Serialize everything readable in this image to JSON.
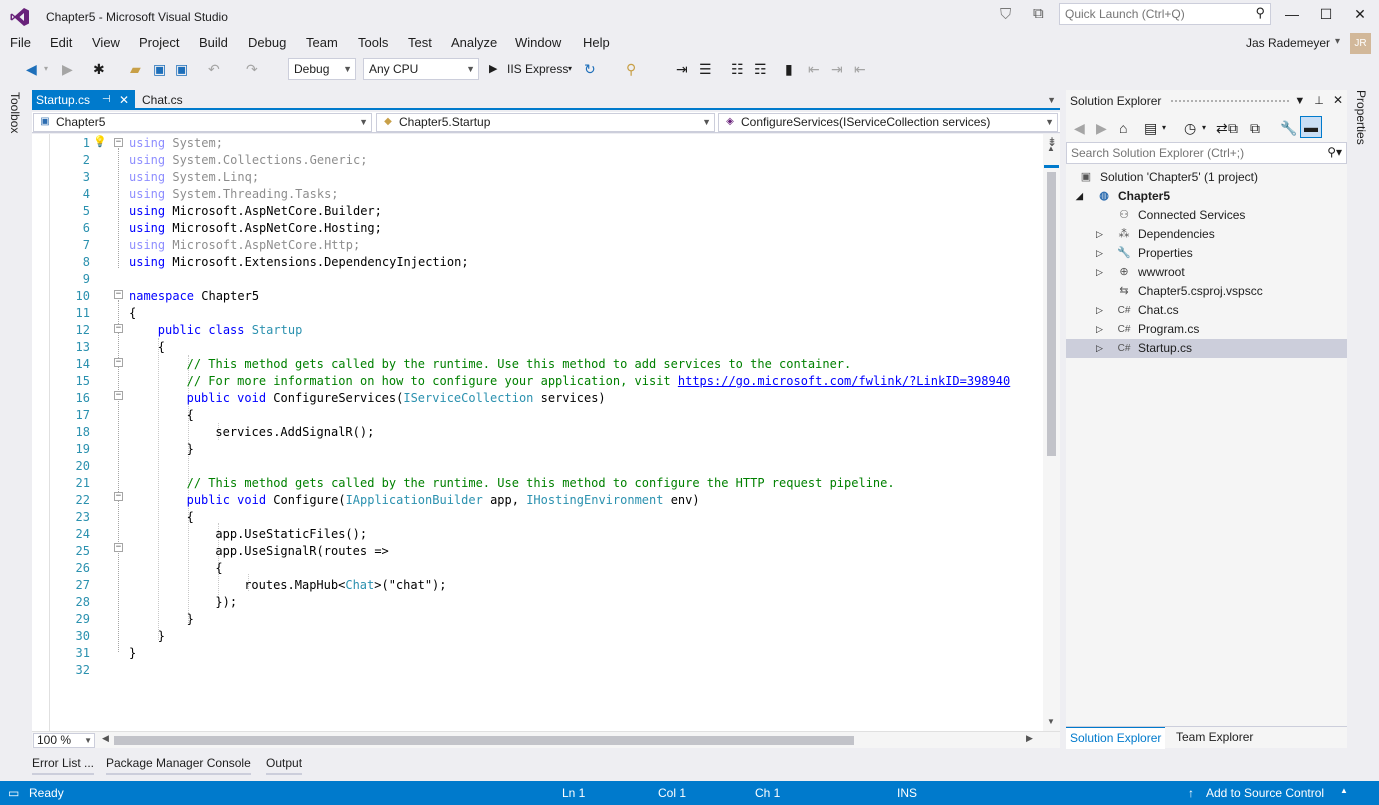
{
  "window": {
    "title": "Chapter5 - Microsoft Visual Studio",
    "quick_launch_placeholder": "Quick Launch (Ctrl+Q)",
    "controls": {
      "minimize": "—",
      "maximize": "☐",
      "close": "✕"
    }
  },
  "menu": [
    "File",
    "Edit",
    "View",
    "Project",
    "Build",
    "Debug",
    "Team",
    "Tools",
    "Test",
    "Analyze",
    "Window",
    "Help"
  ],
  "user": {
    "name": "Jas Rademeyer",
    "initials": "JR"
  },
  "toolbar": {
    "configuration": "Debug",
    "platform": "Any CPU",
    "run_target": "IIS Express"
  },
  "side_tabs": {
    "left": "Toolbox",
    "right": "Properties"
  },
  "editor": {
    "tabs": [
      {
        "label": "Startup.cs",
        "active": true
      },
      {
        "label": "Chat.cs",
        "active": false
      }
    ],
    "nav": {
      "project": "Chapter5",
      "type": "Chapter5.Startup",
      "member": "ConfigureServices(IServiceCollection services)"
    },
    "line_numbers": [
      "1",
      "2",
      "3",
      "4",
      "5",
      "6",
      "7",
      "8",
      "9",
      "10",
      "11",
      "12",
      "13",
      "14",
      "15",
      "16",
      "17",
      "18",
      "19",
      "20",
      "21",
      "22",
      "23",
      "24",
      "25",
      "26",
      "27",
      "28",
      "29",
      "30",
      "31",
      "32"
    ],
    "code": {
      "l1_kw": "using",
      "l1_tx": " System;",
      "l2_kw": "using",
      "l2_tx": " System.Collections.Generic;",
      "l3_kw": "using",
      "l3_tx": " System.Linq;",
      "l4_kw": "using",
      "l4_tx": " System.Threading.Tasks;",
      "l5_kw": "using",
      "l5_tx": " Microsoft.AspNetCore.Builder;",
      "l6_kw": "using",
      "l6_tx": " Microsoft.AspNetCore.Hosting;",
      "l7_kw": "using",
      "l7_tx": " Microsoft.AspNetCore.Http;",
      "l8_kw": "using",
      "l8_tx": " Microsoft.Extensions.DependencyInjection;",
      "l10_kw": "namespace",
      "l10_tx": " Chapter5",
      "l11": "{",
      "l12_kw": "public class",
      "l12_ty": "Startup",
      "l13": "{",
      "l14": "// This method gets called by the runtime. Use this method to add services to the container.",
      "l15_cm": "// For more information on how to configure your application, visit ",
      "l15_link": "https://go.microsoft.com/fwlink/?LinkID=398940",
      "l16_kw": "public void",
      "l16_a": " ConfigureServices(",
      "l16_ty": "IServiceCollection",
      "l16_b": " services)",
      "l17": "{",
      "l18": "services.AddSignalR();",
      "l19": "}",
      "l21": "// This method gets called by the runtime. Use this method to configure the HTTP request pipeline.",
      "l22_kw": "public void",
      "l22_a": " Configure(",
      "l22_ty1": "IApplicationBuilder",
      "l22_b": " app, ",
      "l22_ty2": "IHostingEnvironment",
      "l22_c": " env)",
      "l23": "{",
      "l24": "app.UseStaticFiles();",
      "l25": "app.UseSignalR(routes =>",
      "l26": "{",
      "l27_a": "routes.MapHub<",
      "l27_ty": "Chat",
      "l27_b": ">(\"chat\");",
      "l28": "});",
      "l29": "}",
      "l30": "}",
      "l31": "}"
    },
    "zoom": "100 %"
  },
  "solution_explorer": {
    "title": "Solution Explorer",
    "search_placeholder": "Search Solution Explorer (Ctrl+;)",
    "tree": {
      "solution": "Solution 'Chapter5' (1 project)",
      "project": "Chapter5",
      "connected": "Connected Services",
      "dependencies": "Dependencies",
      "properties": "Properties",
      "wwwroot": "wwwroot",
      "vspscc": "Chapter5.csproj.vspscc",
      "chat": "Chat.cs",
      "program": "Program.cs",
      "startup": "Startup.cs"
    },
    "tabs": [
      "Solution Explorer",
      "Team Explorer"
    ]
  },
  "tool_windows": [
    "Error List ...",
    "Package Manager Console",
    "Output"
  ],
  "status": {
    "state": "Ready",
    "ln": "Ln 1",
    "col": "Col 1",
    "ch": "Ch 1",
    "mode": "INS",
    "source_control": "Add to Source Control"
  },
  "colors": {
    "accent": "#007ACC",
    "keyword": "#0000FF",
    "type": "#2B91AF",
    "comment": "#008000",
    "chrome": "#EEEEF2"
  }
}
